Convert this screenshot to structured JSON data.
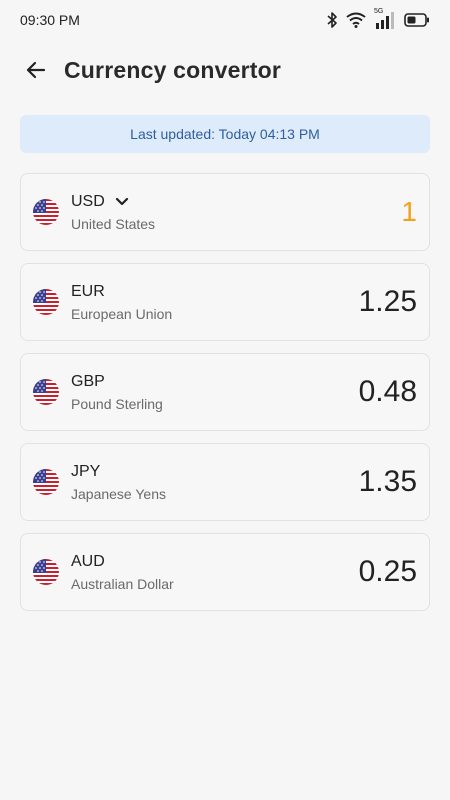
{
  "status_bar": {
    "time": "09:30 PM",
    "icons": [
      "bluetooth-icon",
      "wifi-icon",
      "cellular-5g-icon",
      "battery-icon"
    ],
    "network_label": "5G"
  },
  "header": {
    "back_icon": "arrow-left-icon",
    "title": "Currency convertor"
  },
  "banner": {
    "text": "Last updated: Today 04:13 PM"
  },
  "colors": {
    "base_amount": "#f0a11c",
    "banner_bg": "#ddebfb",
    "banner_text": "#2f5f9e"
  },
  "currencies": [
    {
      "code": "USD",
      "name": "United States",
      "amount": "1",
      "is_base": true,
      "flag_icon": "us-flag-icon"
    },
    {
      "code": "EUR",
      "name": "European Union",
      "amount": "1.25",
      "is_base": false,
      "flag_icon": "us-flag-icon"
    },
    {
      "code": "GBP",
      "name": "Pound Sterling",
      "amount": "0.48",
      "is_base": false,
      "flag_icon": "us-flag-icon"
    },
    {
      "code": "JPY",
      "name": "Japanese Yens",
      "amount": "1.35",
      "is_base": false,
      "flag_icon": "us-flag-icon"
    },
    {
      "code": "AUD",
      "name": "Australian Dollar",
      "amount": "0.25",
      "is_base": false,
      "flag_icon": "us-flag-icon"
    }
  ]
}
